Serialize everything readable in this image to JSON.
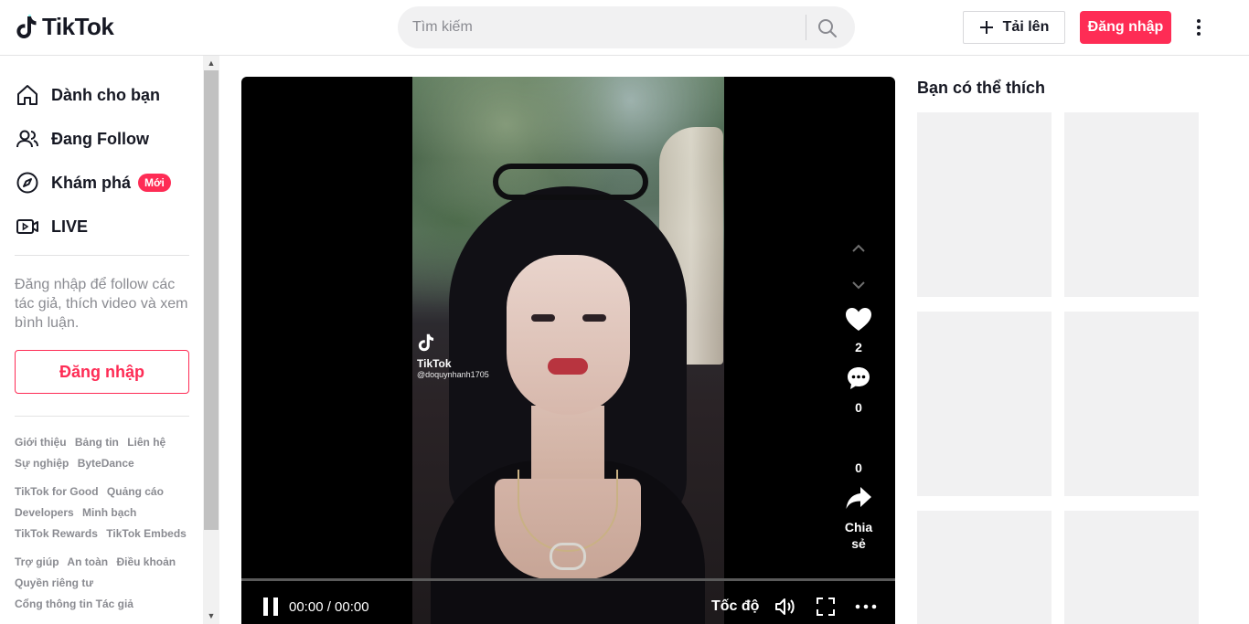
{
  "header": {
    "logo_text": "TikTok",
    "search": {
      "placeholder": "Tìm kiếm"
    },
    "upload_label": "Tải lên",
    "login_label": "Đăng nhập"
  },
  "sidebar": {
    "nav": [
      {
        "label": "Dành cho bạn",
        "icon": "home-icon"
      },
      {
        "label": "Đang Follow",
        "icon": "following-icon"
      },
      {
        "label": "Khám phá",
        "icon": "explore-icon",
        "badge": "Mới"
      },
      {
        "label": "LIVE",
        "icon": "live-icon"
      }
    ],
    "login_prompt": "Đăng nhập để follow các tác giả, thích video và xem bình luận.",
    "login_button": "Đăng nhập",
    "footer": [
      [
        "Giới thiệu",
        "Bảng tin",
        "Liên hệ",
        "Sự nghiệp",
        "ByteDance"
      ],
      [
        "TikTok for Good",
        "Quảng cáo",
        "Developers",
        "Minh bạch",
        "TikTok Rewards",
        "TikTok Embeds"
      ],
      [
        "Trợ giúp",
        "An toàn",
        "Điều khoản",
        "Quyền riêng tư",
        "Cổng thông tin Tác giả"
      ]
    ]
  },
  "video": {
    "watermark_name": "TikTok",
    "watermark_handle": "@doquynhanh1705",
    "likes": "2",
    "comments": "0",
    "shares": "0",
    "share_label": "Chia sẻ",
    "time": "00:00 / 00:00",
    "speed_label": "Tốc độ",
    "progress": 0
  },
  "recommendations": {
    "title": "Bạn có thể thích"
  },
  "colors": {
    "brand": "#fe2c55",
    "text": "#161823",
    "muted": "#8a8b91",
    "placeholder_bg": "#f1f1f2"
  }
}
